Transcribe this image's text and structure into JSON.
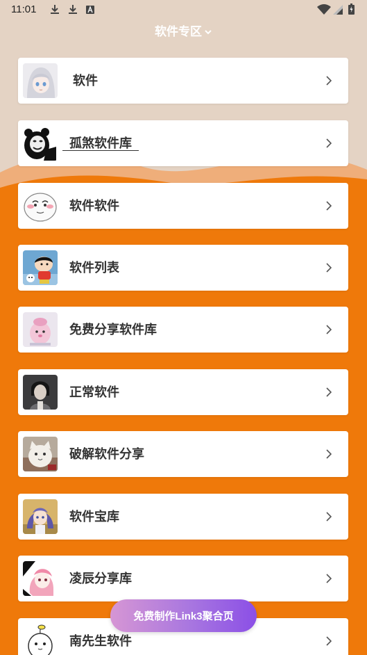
{
  "status_bar": {
    "time": "11:01",
    "icons": [
      "download-icon",
      "download-icon",
      "a-box-icon",
      "wifi-icon",
      "signal-icon",
      "battery-icon"
    ]
  },
  "header": {
    "title": "软件专区",
    "icon": "chevron-down-icon"
  },
  "items": [
    {
      "label": "软件",
      "avatar": "anime-girl-avatar"
    },
    {
      "label": "孤煞软件库",
      "avatar": "panda-meme-avatar"
    },
    {
      "label": "软件软件",
      "avatar": "smiley-face-avatar"
    },
    {
      "label": "软件列表",
      "avatar": "cartoon-kid-avatar"
    },
    {
      "label": "免费分享软件库",
      "avatar": "pink-plush-avatar"
    },
    {
      "label": "正常软件",
      "avatar": "photo-person-avatar"
    },
    {
      "label": "破解软件分享",
      "avatar": "cat-avatar"
    },
    {
      "label": "软件宝库",
      "avatar": "anime-girl-purple-avatar"
    },
    {
      "label": "凌辰分享库",
      "avatar": "anime-girl-pink-avatar"
    },
    {
      "label": "南先生软件",
      "avatar": "white-cartoon-avatar"
    }
  ],
  "cta": {
    "label": "免费制作Link3聚合页"
  },
  "colors": {
    "background_top": "#e4d3c4",
    "background_orange": "#ef790a",
    "card": "#ffffff",
    "text": "#333333",
    "cta_gradient_start": "#d696d4",
    "cta_gradient_end": "#8b4fe6"
  }
}
